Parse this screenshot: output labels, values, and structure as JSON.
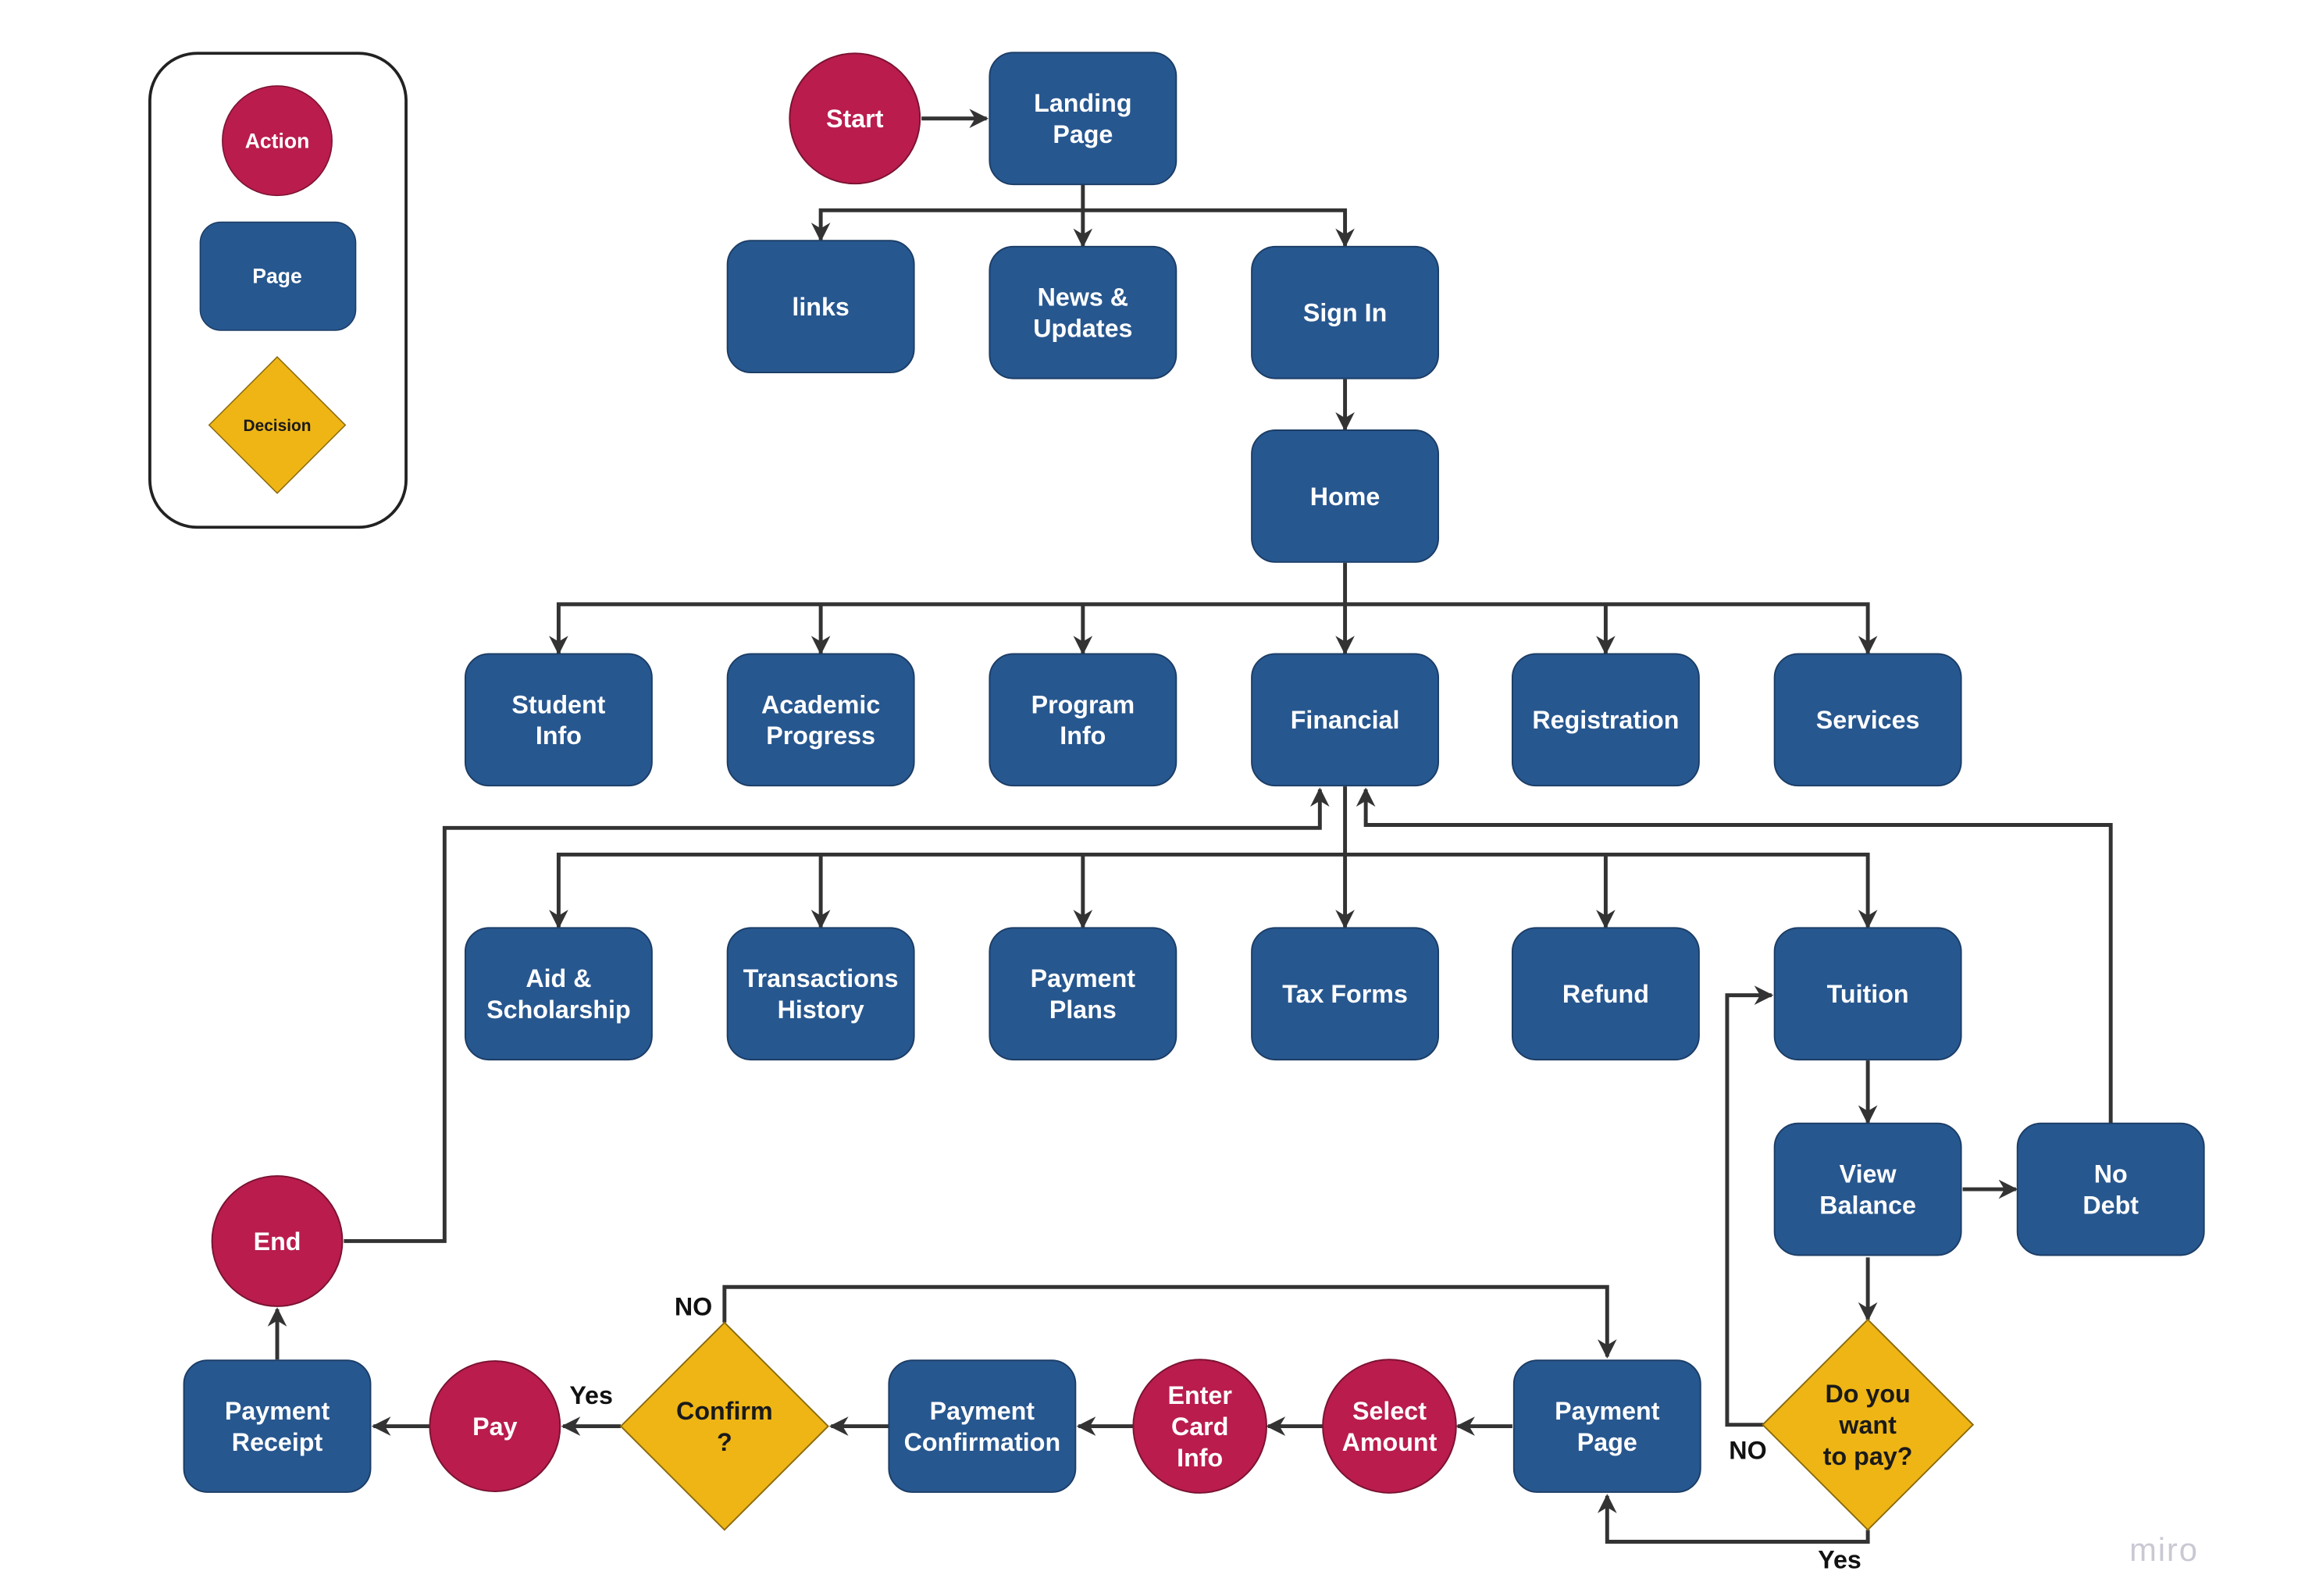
{
  "colors": {
    "page": "#27578F",
    "action": "#B91C4D",
    "decision": "#EEB515",
    "connector": "#333333",
    "watermark": "#C9C9D4"
  },
  "legend": {
    "action": "Action",
    "page": "Page",
    "decision": "Decision"
  },
  "nodes": {
    "start": {
      "type": "action",
      "lines": [
        "Start"
      ]
    },
    "landing": {
      "type": "page",
      "lines": [
        "Landing",
        "Page"
      ]
    },
    "links": {
      "type": "page",
      "lines": [
        "links"
      ]
    },
    "news": {
      "type": "page",
      "lines": [
        "News &",
        "Updates"
      ]
    },
    "signin": {
      "type": "page",
      "lines": [
        "Sign In"
      ]
    },
    "home": {
      "type": "page",
      "lines": [
        "Home"
      ]
    },
    "student": {
      "type": "page",
      "lines": [
        "Student",
        "Info"
      ]
    },
    "academic": {
      "type": "page",
      "lines": [
        "Academic",
        "Progress"
      ]
    },
    "program": {
      "type": "page",
      "lines": [
        "Program",
        "Info"
      ]
    },
    "financial": {
      "type": "page",
      "lines": [
        "Financial"
      ]
    },
    "registration": {
      "type": "page",
      "lines": [
        "Registration"
      ]
    },
    "services": {
      "type": "page",
      "lines": [
        "Services"
      ]
    },
    "aid": {
      "type": "page",
      "lines": [
        "Aid &",
        "Scholarship"
      ]
    },
    "transactions": {
      "type": "page",
      "lines": [
        "Transactions",
        "History"
      ]
    },
    "plans": {
      "type": "page",
      "lines": [
        "Payment",
        "Plans"
      ]
    },
    "tax": {
      "type": "page",
      "lines": [
        "Tax Forms"
      ]
    },
    "refund": {
      "type": "page",
      "lines": [
        "Refund"
      ]
    },
    "tuition": {
      "type": "page",
      "lines": [
        "Tuition"
      ]
    },
    "viewbalance": {
      "type": "page",
      "lines": [
        "View",
        "Balance"
      ]
    },
    "nodebt": {
      "type": "page",
      "lines": [
        "No",
        "Debt"
      ]
    },
    "wantpay": {
      "type": "decision",
      "lines": [
        "Do you",
        "want",
        "to pay?"
      ]
    },
    "paypage": {
      "type": "page",
      "lines": [
        "Payment",
        "Page"
      ]
    },
    "selectamount": {
      "type": "action",
      "lines": [
        "Select",
        "Amount"
      ]
    },
    "entercard": {
      "type": "action",
      "lines": [
        "Enter",
        "Card",
        "Info"
      ]
    },
    "payconfirm": {
      "type": "page",
      "lines": [
        "Payment",
        "Confirmation"
      ]
    },
    "confirm": {
      "type": "decision",
      "lines": [
        "Confirm",
        "?"
      ]
    },
    "pay": {
      "type": "action",
      "lines": [
        "Pay"
      ]
    },
    "receipt": {
      "type": "page",
      "lines": [
        "Payment",
        "Receipt"
      ]
    },
    "end": {
      "type": "action",
      "lines": [
        "End"
      ]
    }
  },
  "edge_labels": {
    "confirm_no": "NO",
    "confirm_yes": "Yes",
    "wantpay_no": "NO",
    "wantpay_yes": "Yes"
  },
  "watermark": "miro"
}
